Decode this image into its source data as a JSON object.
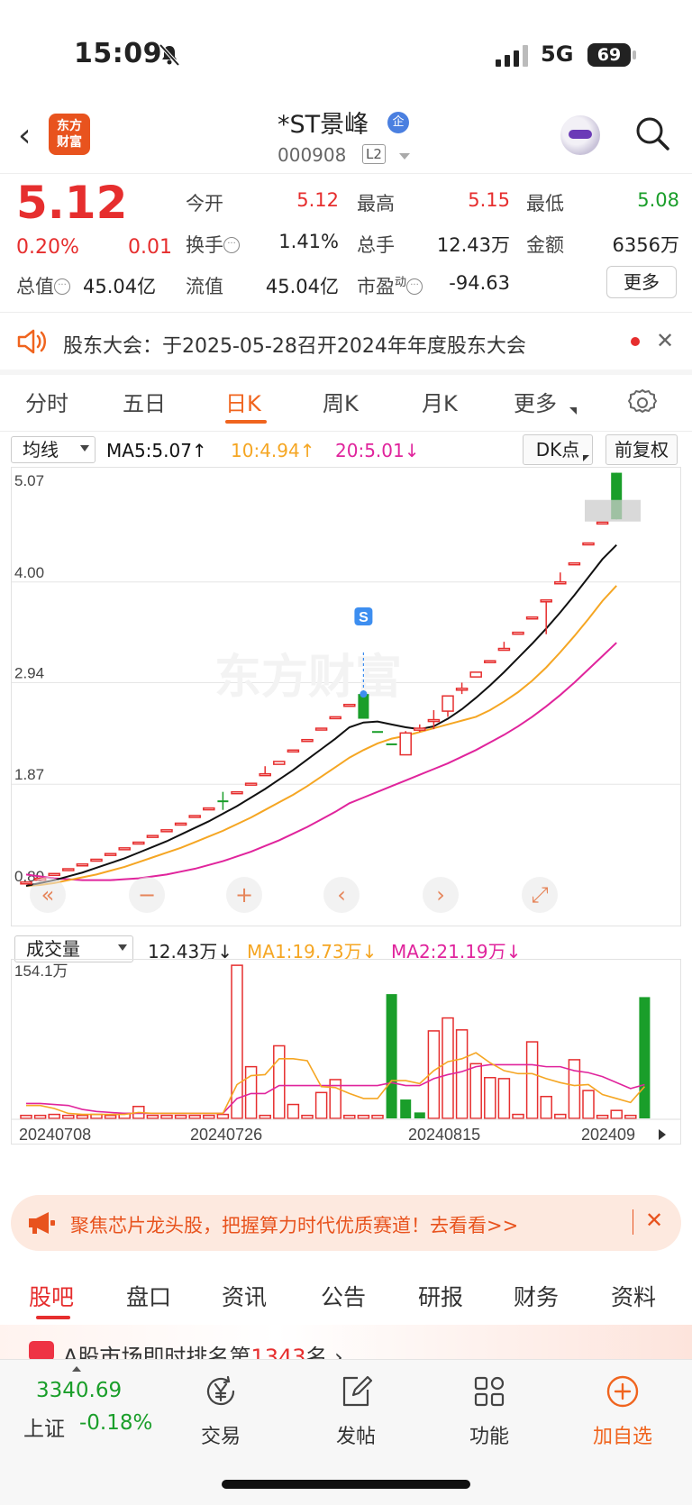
{
  "status_bar": {
    "time": "15:09",
    "network": "5G",
    "battery": "69"
  },
  "header": {
    "logo_line1": "东方",
    "logo_line2": "财富",
    "title": "*ST景峰",
    "title_badge": "企",
    "code": "000908",
    "level": "L2"
  },
  "quote": {
    "price": "5.12",
    "change_pct": "0.20%",
    "change": "0.01",
    "stats": [
      {
        "label": "今开",
        "value": "5.12",
        "color": "red"
      },
      {
        "label": "最高",
        "value": "5.15",
        "color": "red"
      },
      {
        "label": "最低",
        "value": "5.08",
        "color": "green"
      },
      {
        "label": "换手",
        "value": "1.41%",
        "color": "dark"
      },
      {
        "label": "总手",
        "value": "12.43万",
        "color": "dark"
      },
      {
        "label": "金额",
        "value": "6356万",
        "color": "dark"
      },
      {
        "label": "总值",
        "value": "45.04亿",
        "color": "dark"
      },
      {
        "label": "流值",
        "value": "45.04亿",
        "color": "dark"
      },
      {
        "label": "市盈",
        "label_sup": "动",
        "value": "-94.63",
        "color": "dark"
      }
    ],
    "more_label": "更多"
  },
  "notice": {
    "text": "股东大会：于2025-05-28召开2024年年度股东大会",
    "close": "✕"
  },
  "period_tabs": [
    "分时",
    "五日",
    "日K",
    "周K",
    "月K",
    "更多"
  ],
  "active_period": "日K",
  "indicator_bar": {
    "selector": "均线",
    "ma5": "MA5:5.07↑",
    "ma10": "10:4.94↑",
    "ma20": "20:5.01↓",
    "dk_label": "DK点",
    "adjust_label": "前复权"
  },
  "colors": {
    "up": "#e62e2e",
    "down": "#1a9e2a",
    "accent": "#f0641e",
    "ma5": "#111111",
    "ma10": "#f5a623",
    "ma20": "#e0249c"
  },
  "price_axis": [
    "5.07",
    "4.00",
    "2.94",
    "1.87",
    "0.80"
  ],
  "signal_marker": "S",
  "watermark": "东方财富",
  "chart_controls": [
    "«",
    "−",
    "+",
    "‹",
    "›",
    "⤢"
  ],
  "volume_bar": {
    "selector": "成交量",
    "vol": "12.43万↓",
    "ma1": "MA1:19.73万↓",
    "ma2": "MA2:21.19万↓",
    "max_label": "154.1万"
  },
  "date_axis": [
    "20240708",
    "20240726",
    "20240815",
    "202409"
  ],
  "chart_data": {
    "type": "candlestick",
    "ylim": [
      0.8,
      5.07
    ],
    "candles": [
      {
        "o": 0.83,
        "c": 0.84,
        "h": 0.84,
        "l": 0.83,
        "dir": "up"
      },
      {
        "o": 0.87,
        "c": 0.88,
        "h": 0.88,
        "l": 0.87,
        "dir": "up"
      },
      {
        "o": 0.92,
        "c": 0.93,
        "h": 0.93,
        "l": 0.92,
        "dir": "up"
      },
      {
        "o": 0.97,
        "c": 0.98,
        "h": 0.98,
        "l": 0.97,
        "dir": "up"
      },
      {
        "o": 1.03,
        "c": 1.03,
        "h": 1.03,
        "l": 1.03,
        "dir": "up"
      },
      {
        "o": 1.08,
        "c": 1.08,
        "h": 1.08,
        "l": 1.08,
        "dir": "up"
      },
      {
        "o": 1.13,
        "c": 1.14,
        "h": 1.14,
        "l": 1.13,
        "dir": "up"
      },
      {
        "o": 1.19,
        "c": 1.2,
        "h": 1.2,
        "l": 1.19,
        "dir": "up"
      },
      {
        "o": 1.26,
        "c": 1.26,
        "h": 1.26,
        "l": 1.26,
        "dir": "up"
      },
      {
        "o": 1.32,
        "c": 1.33,
        "h": 1.33,
        "l": 1.32,
        "dir": "up"
      },
      {
        "o": 1.39,
        "c": 1.39,
        "h": 1.39,
        "l": 1.39,
        "dir": "up"
      },
      {
        "o": 1.46,
        "c": 1.46,
        "h": 1.46,
        "l": 1.46,
        "dir": "up"
      },
      {
        "o": 1.53,
        "c": 1.54,
        "h": 1.54,
        "l": 1.53,
        "dir": "up"
      },
      {
        "o": 1.62,
        "c": 1.62,
        "h": 1.62,
        "l": 1.62,
        "dir": "up"
      },
      {
        "o": 1.7,
        "c": 1.7,
        "h": 1.79,
        "l": 1.6,
        "dir": "down"
      },
      {
        "o": 1.79,
        "c": 1.79,
        "h": 1.79,
        "l": 1.79,
        "dir": "up"
      },
      {
        "o": 1.88,
        "c": 1.88,
        "h": 1.88,
        "l": 1.88,
        "dir": "up"
      },
      {
        "o": 1.97,
        "c": 1.98,
        "h": 2.06,
        "l": 1.97,
        "dir": "up"
      },
      {
        "o": 2.08,
        "c": 2.11,
        "h": 2.11,
        "l": 2.08,
        "dir": "up"
      },
      {
        "o": 2.23,
        "c": 2.23,
        "h": 2.23,
        "l": 2.23,
        "dir": "up"
      },
      {
        "o": 2.34,
        "c": 2.34,
        "h": 2.34,
        "l": 2.34,
        "dir": "up"
      },
      {
        "o": 2.46,
        "c": 2.46,
        "h": 2.46,
        "l": 2.46,
        "dir": "up"
      },
      {
        "o": 2.58,
        "c": 2.58,
        "h": 2.58,
        "l": 2.58,
        "dir": "up"
      },
      {
        "o": 2.71,
        "c": 2.71,
        "h": 2.71,
        "l": 2.71,
        "dir": "up"
      },
      {
        "o": 2.82,
        "c": 2.56,
        "h": 2.82,
        "l": 2.56,
        "dir": "down"
      },
      {
        "o": 2.43,
        "c": 2.43,
        "h": 2.43,
        "l": 2.43,
        "dir": "down"
      },
      {
        "o": 2.3,
        "c": 2.3,
        "h": 2.3,
        "l": 2.3,
        "dir": "down"
      },
      {
        "o": 2.18,
        "c": 2.41,
        "h": 2.43,
        "l": 2.18,
        "dir": "up"
      },
      {
        "o": 2.44,
        "c": 2.46,
        "h": 2.5,
        "l": 2.42,
        "dir": "up"
      },
      {
        "o": 2.55,
        "c": 2.55,
        "h": 2.65,
        "l": 2.45,
        "dir": "up"
      },
      {
        "o": 2.64,
        "c": 2.8,
        "h": 2.8,
        "l": 2.58,
        "dir": "up"
      },
      {
        "o": 2.88,
        "c": 2.88,
        "h": 2.94,
        "l": 2.82,
        "dir": "up"
      },
      {
        "o": 3.0,
        "c": 3.05,
        "h": 3.05,
        "l": 3.0,
        "dir": "up"
      },
      {
        "o": 3.17,
        "c": 3.17,
        "h": 3.17,
        "l": 3.17,
        "dir": "up"
      },
      {
        "o": 3.3,
        "c": 3.3,
        "h": 3.37,
        "l": 3.3,
        "dir": "up"
      },
      {
        "o": 3.45,
        "c": 3.47,
        "h": 3.47,
        "l": 3.45,
        "dir": "up"
      },
      {
        "o": 3.63,
        "c": 3.63,
        "h": 3.63,
        "l": 3.63,
        "dir": "up"
      },
      {
        "o": 3.81,
        "c": 3.81,
        "h": 3.81,
        "l": 3.45,
        "dir": "up"
      },
      {
        "o": 4.0,
        "c": 4.0,
        "h": 4.1,
        "l": 4.0,
        "dir": "up"
      },
      {
        "o": 4.2,
        "c": 4.2,
        "h": 4.2,
        "l": 4.2,
        "dir": "up"
      },
      {
        "o": 4.41,
        "c": 4.41,
        "h": 4.41,
        "l": 4.41,
        "dir": "up"
      },
      {
        "o": 4.63,
        "c": 4.63,
        "h": 4.63,
        "l": 4.63,
        "dir": "up"
      },
      {
        "o": 5.15,
        "c": 4.66,
        "h": 5.15,
        "l": 4.66,
        "dir": "down"
      }
    ],
    "ma5": [
      0.8,
      0.83,
      0.86,
      0.9,
      0.94,
      0.99,
      1.04,
      1.09,
      1.15,
      1.21,
      1.27,
      1.34,
      1.41,
      1.48,
      1.56,
      1.64,
      1.73,
      1.82,
      1.92,
      2.02,
      2.13,
      2.24,
      2.35,
      2.47,
      2.52,
      2.53,
      2.5,
      2.47,
      2.45,
      2.48,
      2.56,
      2.66,
      2.78,
      2.91,
      3.05,
      3.2,
      3.35,
      3.51,
      3.68,
      3.86,
      4.05,
      4.24,
      4.39
    ],
    "ma10": [
      0.8,
      0.81,
      0.83,
      0.86,
      0.89,
      0.92,
      0.96,
      1.0,
      1.05,
      1.1,
      1.15,
      1.2,
      1.26,
      1.32,
      1.38,
      1.45,
      1.52,
      1.6,
      1.68,
      1.76,
      1.85,
      1.95,
      2.05,
      2.15,
      2.23,
      2.3,
      2.35,
      2.38,
      2.42,
      2.46,
      2.5,
      2.54,
      2.58,
      2.65,
      2.74,
      2.84,
      2.96,
      3.1,
      3.26,
      3.43,
      3.61,
      3.8,
      3.96
    ],
    "ma20": [
      0.92,
      0.9,
      0.88,
      0.87,
      0.86,
      0.86,
      0.86,
      0.87,
      0.88,
      0.9,
      0.92,
      0.95,
      0.98,
      1.02,
      1.06,
      1.11,
      1.16,
      1.22,
      1.28,
      1.35,
      1.42,
      1.5,
      1.58,
      1.67,
      1.73,
      1.79,
      1.85,
      1.91,
      1.97,
      2.03,
      2.09,
      2.16,
      2.23,
      2.31,
      2.39,
      2.48,
      2.58,
      2.69,
      2.81,
      2.94,
      3.08,
      3.22,
      3.36
    ],
    "volume": {
      "max": 154.1,
      "values": [
        3,
        3,
        4,
        3,
        3,
        4,
        3,
        5,
        12,
        3,
        3,
        3,
        3,
        3,
        4,
        154,
        52,
        3,
        73,
        14,
        3,
        26,
        39,
        3,
        3,
        3,
        125,
        19,
        6,
        88,
        101,
        89,
        55,
        41,
        40,
        4,
        77,
        22,
        4,
        59,
        28,
        3,
        8,
        3,
        122
      ],
      "dirs": [
        "up",
        "up",
        "up",
        "up",
        "up",
        "up",
        "up",
        "up",
        "up",
        "up",
        "up",
        "up",
        "up",
        "up",
        "up",
        "up",
        "up",
        "up",
        "up",
        "up",
        "up",
        "up",
        "up",
        "up",
        "up",
        "up",
        "down",
        "down",
        "down",
        "up",
        "up",
        "up",
        "up",
        "up",
        "up",
        "up",
        "up",
        "up",
        "up",
        "up",
        "up",
        "up",
        "up",
        "up",
        "down"
      ],
      "ma1": [
        13,
        13,
        10,
        5,
        4,
        4,
        4,
        4,
        6,
        5,
        5,
        5,
        5,
        5,
        5,
        34,
        43,
        44,
        60,
        60,
        58,
        32,
        31,
        25,
        20,
        20,
        38,
        38,
        35,
        48,
        57,
        60,
        66,
        56,
        48,
        45,
        45,
        40,
        36,
        33,
        34,
        24,
        20,
        16,
        32
      ],
      "ma2": [
        15,
        15,
        14,
        13,
        9,
        7,
        6,
        5,
        5,
        5,
        5,
        5,
        5,
        5,
        5,
        20,
        25,
        25,
        33,
        33,
        33,
        33,
        33,
        33,
        33,
        33,
        36,
        33,
        33,
        40,
        44,
        47,
        52,
        54,
        54,
        54,
        54,
        52,
        52,
        48,
        46,
        42,
        36,
        30,
        34
      ]
    }
  },
  "promo": {
    "text": "聚焦芯片龙头股，把握算力时代优质赛道！去看看>>",
    "close": "✕"
  },
  "bottom_tabs": [
    "股吧",
    "盘口",
    "资讯",
    "公告",
    "研报",
    "财务",
    "资料"
  ],
  "rank": {
    "prefix": "A股市场即时排名第",
    "rank": "1343",
    "suffix": "名"
  },
  "bottom_nav": {
    "index_value": "3340.69",
    "index_name": "上证",
    "index_pct": "-0.18%",
    "items": [
      {
        "label": "交易",
        "icon": "yen-icon"
      },
      {
        "label": "发帖",
        "icon": "edit-icon"
      },
      {
        "label": "功能",
        "icon": "grid-icon"
      },
      {
        "label": "加自选",
        "icon": "add-icon"
      }
    ]
  }
}
